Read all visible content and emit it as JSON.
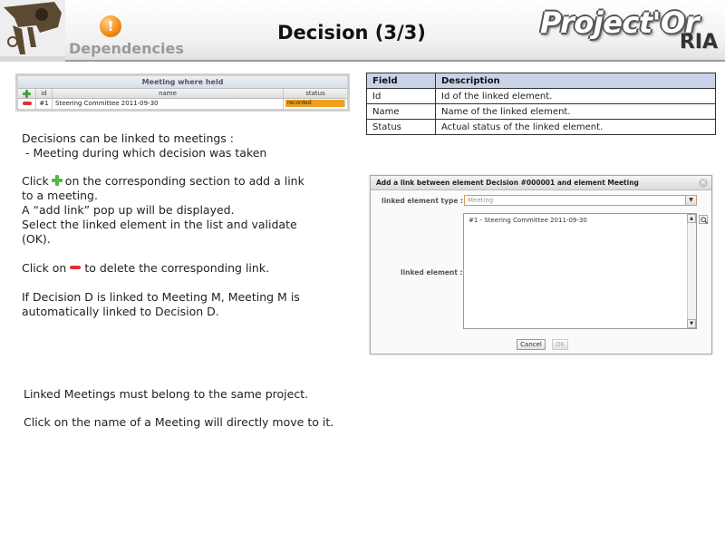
{
  "header": {
    "dependencies_icon": "!",
    "dependencies_label": "Dependencies",
    "title": "Decision (3/3)",
    "brand_main": "Project'Or",
    "brand_sub": "RIA"
  },
  "meeting_table": {
    "title": "Meeting where held",
    "columns": {
      "id": "id",
      "name": "name",
      "status": "status"
    },
    "rows": [
      {
        "id": "#1",
        "name": "Steering Committee 2011-09-30",
        "status": "recorded"
      }
    ],
    "status_color": "#f0a020"
  },
  "field_table": {
    "headers": {
      "field": "Field",
      "description": "Description"
    },
    "rows": [
      {
        "field": "Id",
        "description": "Id of the linked element."
      },
      {
        "field": "Name",
        "description": "Name of the linked element."
      },
      {
        "field": "Status",
        "description": "Actual status of the linked element."
      }
    ]
  },
  "text": {
    "p1_line1": "Decisions can be linked to meetings :",
    "p1_line2": " - Meeting during which decision was taken",
    "p2_pre": "Click",
    "p2_post": "on the corresponding section to add a link",
    "p2_line2": "to a meeting.",
    "p2_line3": "A “add link” pop up will be displayed.",
    "p2_line4": "Select the linked element in the list and validate",
    "p2_line5": "(OK).",
    "p3_pre": "Click on",
    "p3_post": "to delete the corresponding link.",
    "p4_line1": "If Decision D is linked to Meeting M, Meeting M is",
    "p4_line2": "automatically linked to Decision D.",
    "p5": "Linked Meetings must belong to the same project.",
    "p6": "Click on the name of a Meeting will directly move to it."
  },
  "dialog": {
    "title": "Add a link between element Decision #000001 and element Meeting",
    "type_label": "linked element type :",
    "type_value": "Meeting",
    "element_label": "linked element :",
    "options": [
      "#1 - Steering Committee 2011-09-30"
    ],
    "cancel_label": "Cancel",
    "ok_label": "OK"
  },
  "colors": {
    "add": "#52b84a",
    "remove": "#e03030",
    "table_header": "#c9d3e8"
  },
  "icons": [
    "dependencies-warning-icon",
    "add-plus-icon",
    "remove-minus-icon",
    "search-icon",
    "close-icon"
  ]
}
